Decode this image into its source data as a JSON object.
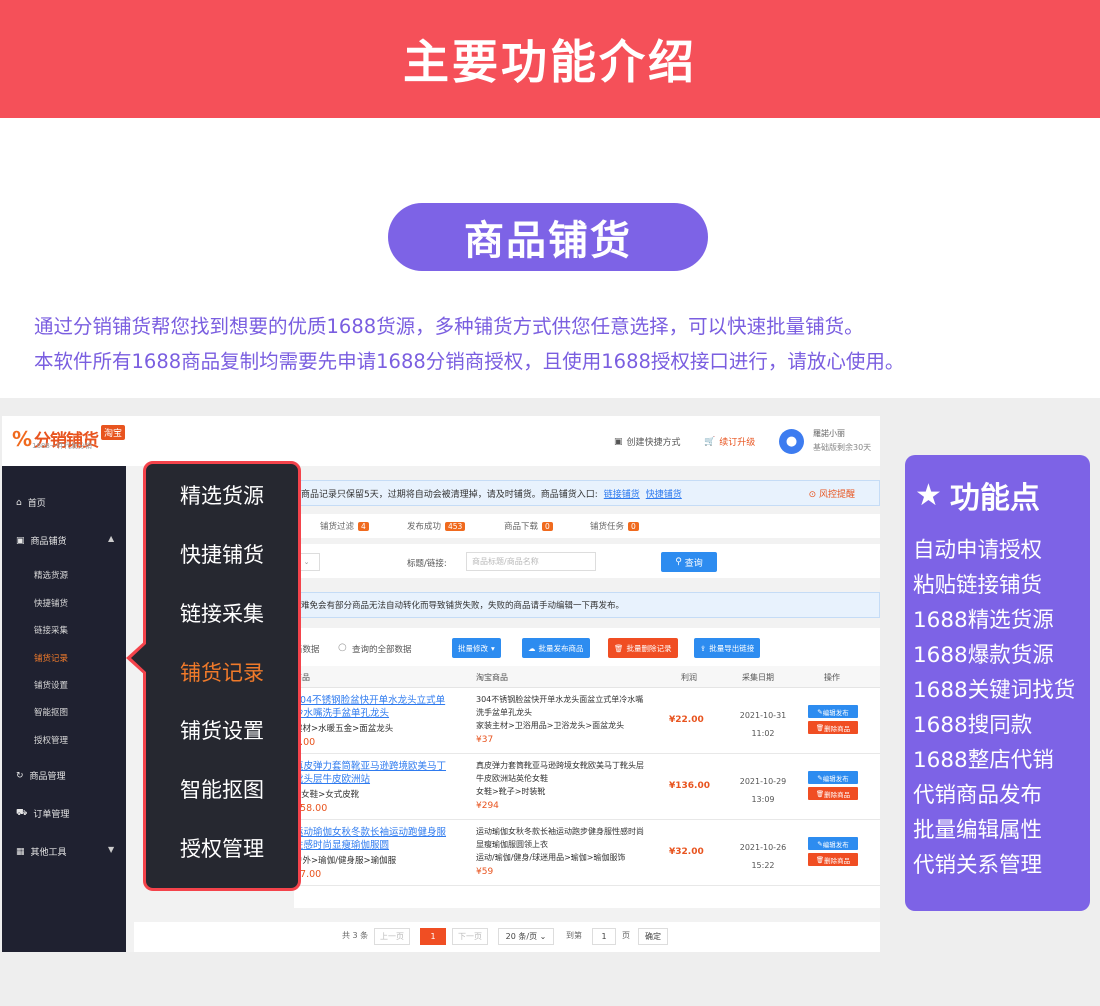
{
  "banner": {
    "title": "主要功能介绍"
  },
  "section": {
    "pill": "商品铺货"
  },
  "description": {
    "line1": "通过分销铺货帮您找到想要的优质1688货源，多种铺货方式供您任意选择，可以快速批量铺货。",
    "line2": "本软件所有1688商品复制均需要先申请1688分销商授权，且使用1688授权接口进行，请放心使用。"
  },
  "app": {
    "logo": {
      "mark": "%",
      "text": "分销铺货",
      "badge": "淘宝",
      "subtitle": "1688一件代发分销"
    },
    "header": {
      "quick_create": "创建快捷方式",
      "upgrade": "续订升级",
      "user_name": "羅諾小丽",
      "user_plan": "基础版剩余30天"
    },
    "sidebar": {
      "home": "首页",
      "distribution": "商品铺货",
      "sub_items": [
        "精选货源",
        "快捷铺货",
        "链接采集",
        "铺货记录",
        "铺货设置",
        "智能抠图",
        "授权管理"
      ],
      "active_sub": "铺货记录",
      "product_mgmt": "商品管理",
      "order_mgmt": "订单管理",
      "other_tools": "其他工具"
    },
    "notice": {
      "text": "商品记录只保留5天，过期将自动会被清理掉，请及时铺货。商品铺货入口:",
      "link1": "链接铺货",
      "link2": "快捷铺货",
      "risk": "风控提醒"
    },
    "tabs": [
      {
        "label": "铺货过滤",
        "count": "4"
      },
      {
        "label": "发布成功",
        "count": "453"
      },
      {
        "label": "商品下载",
        "count": "0"
      },
      {
        "label": "铺货任务",
        "count": "0"
      }
    ],
    "filter": {
      "label": "标题/链接:",
      "placeholder": "商品标题/商品名称",
      "search": "查询"
    },
    "warning": "难免会有部分商品无法自动转化而导致铺货失败，失败的商品请手动编辑一下再发布。",
    "actions": {
      "scope_current": "当数据",
      "scope_all": "查询的全部数据",
      "batch_edit": "批量修改",
      "batch_publish": "批量发布商品",
      "batch_delete": "批量删除记录",
      "batch_export": "批量导出链接"
    },
    "table": {
      "headers": [
        "商品",
        "淘宝商品",
        "利润",
        "采集日期",
        "操作"
      ],
      "rows": [
        {
          "title": "304不锈钢脸盆快开单水龙头立式单冷水嘴洗手盆单孔龙头",
          "category": "建材>水暖五金>面盆龙头",
          "price": "5.00",
          "tb_title": "304不锈钢脸盆快开单水龙头面盆立式单冷水嘴洗手盆单孔龙头",
          "tb_category": "家装主材>卫浴用品>卫浴龙头>面盆龙头",
          "tb_price": "¥37",
          "profit": "¥22.00",
          "date": "2021-10-31",
          "time": "11:02"
        },
        {
          "title": "真皮弹力套筒靴亚马逊跨境欧美马丁靴头层牛皮欧洲站",
          "category": ">女鞋>女式皮靴",
          "price": "158.00",
          "tb_title": "真皮弹力套筒靴亚马逊跨境女靴欧美马丁靴头层牛皮欧洲站英伦女鞋",
          "tb_category": "女鞋>靴子>时装靴",
          "tb_price": "¥294",
          "profit": "¥136.00",
          "date": "2021-10-29",
          "time": "13:09"
        },
        {
          "title": "运动瑜伽女秋冬款长袖运动跑健身服性感时尚显瘦瑜伽服圆",
          "category": "户外>瑜伽/健身服>瑜伽服",
          "price": "27.00",
          "tb_title": "运动瑜伽女秋冬款长袖运动跑步健身服性感时尚显瘦瑜伽服圆领上衣",
          "tb_category": "运动/瑜伽/健身/球迷用品>瑜伽>瑜伽服饰",
          "tb_price": "¥59",
          "profit": "¥32.00",
          "date": "2021-10-26",
          "time": "15:22"
        }
      ],
      "op_edit": "编辑发布",
      "op_delete": "删除商品"
    },
    "pager": {
      "total": "共 3 条",
      "prev": "上一页",
      "current": "1",
      "next": "下一页",
      "page_size": "20 条/页",
      "goto": "到第",
      "goto_value": "1",
      "page_unit": "页",
      "confirm": "确定"
    }
  },
  "popup_menu": {
    "items": [
      "精选货源",
      "快捷铺货",
      "链接采集",
      "铺货记录",
      "铺货设置",
      "智能抠图",
      "授权管理"
    ],
    "active": "铺货记录"
  },
  "features": {
    "title": "功能点",
    "items": [
      "自动申请授权",
      "粘贴链接铺货",
      "1688精选货源",
      "1688爆款货源",
      "1688关键词找货",
      "1688搜同款",
      "1688整店代销",
      "代销商品发布",
      "批量编辑属性",
      "代销关系管理"
    ]
  },
  "colors": {
    "banner": "#f55059",
    "accent_purple": "#7d63e6",
    "accent_orange": "#f07a2a",
    "link_blue": "#2f7bef"
  }
}
